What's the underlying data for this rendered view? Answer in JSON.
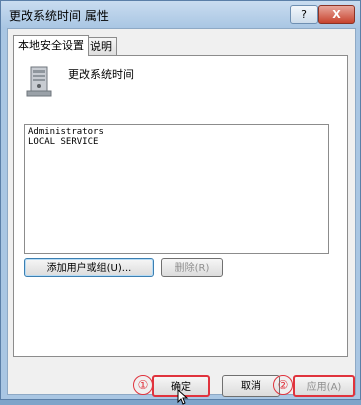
{
  "window": {
    "title": "更改系统时间 属性",
    "help_button": "?",
    "close_button": "X"
  },
  "tabs": [
    {
      "label": "本地安全设置",
      "active": true
    },
    {
      "label": "说明",
      "active": false
    }
  ],
  "policy": {
    "name": "更改系统时间",
    "icon": "policy-icon"
  },
  "principals": [
    "Administrators",
    "LOCAL SERVICE"
  ],
  "buttons": {
    "add": "添加用户或组(U)...",
    "remove": "删除(R)",
    "ok": "确定",
    "cancel": "取消",
    "apply": "应用(A)"
  },
  "annotations": {
    "marker_1": "①",
    "marker_2": "②",
    "highlight_color": "#e0333d"
  }
}
